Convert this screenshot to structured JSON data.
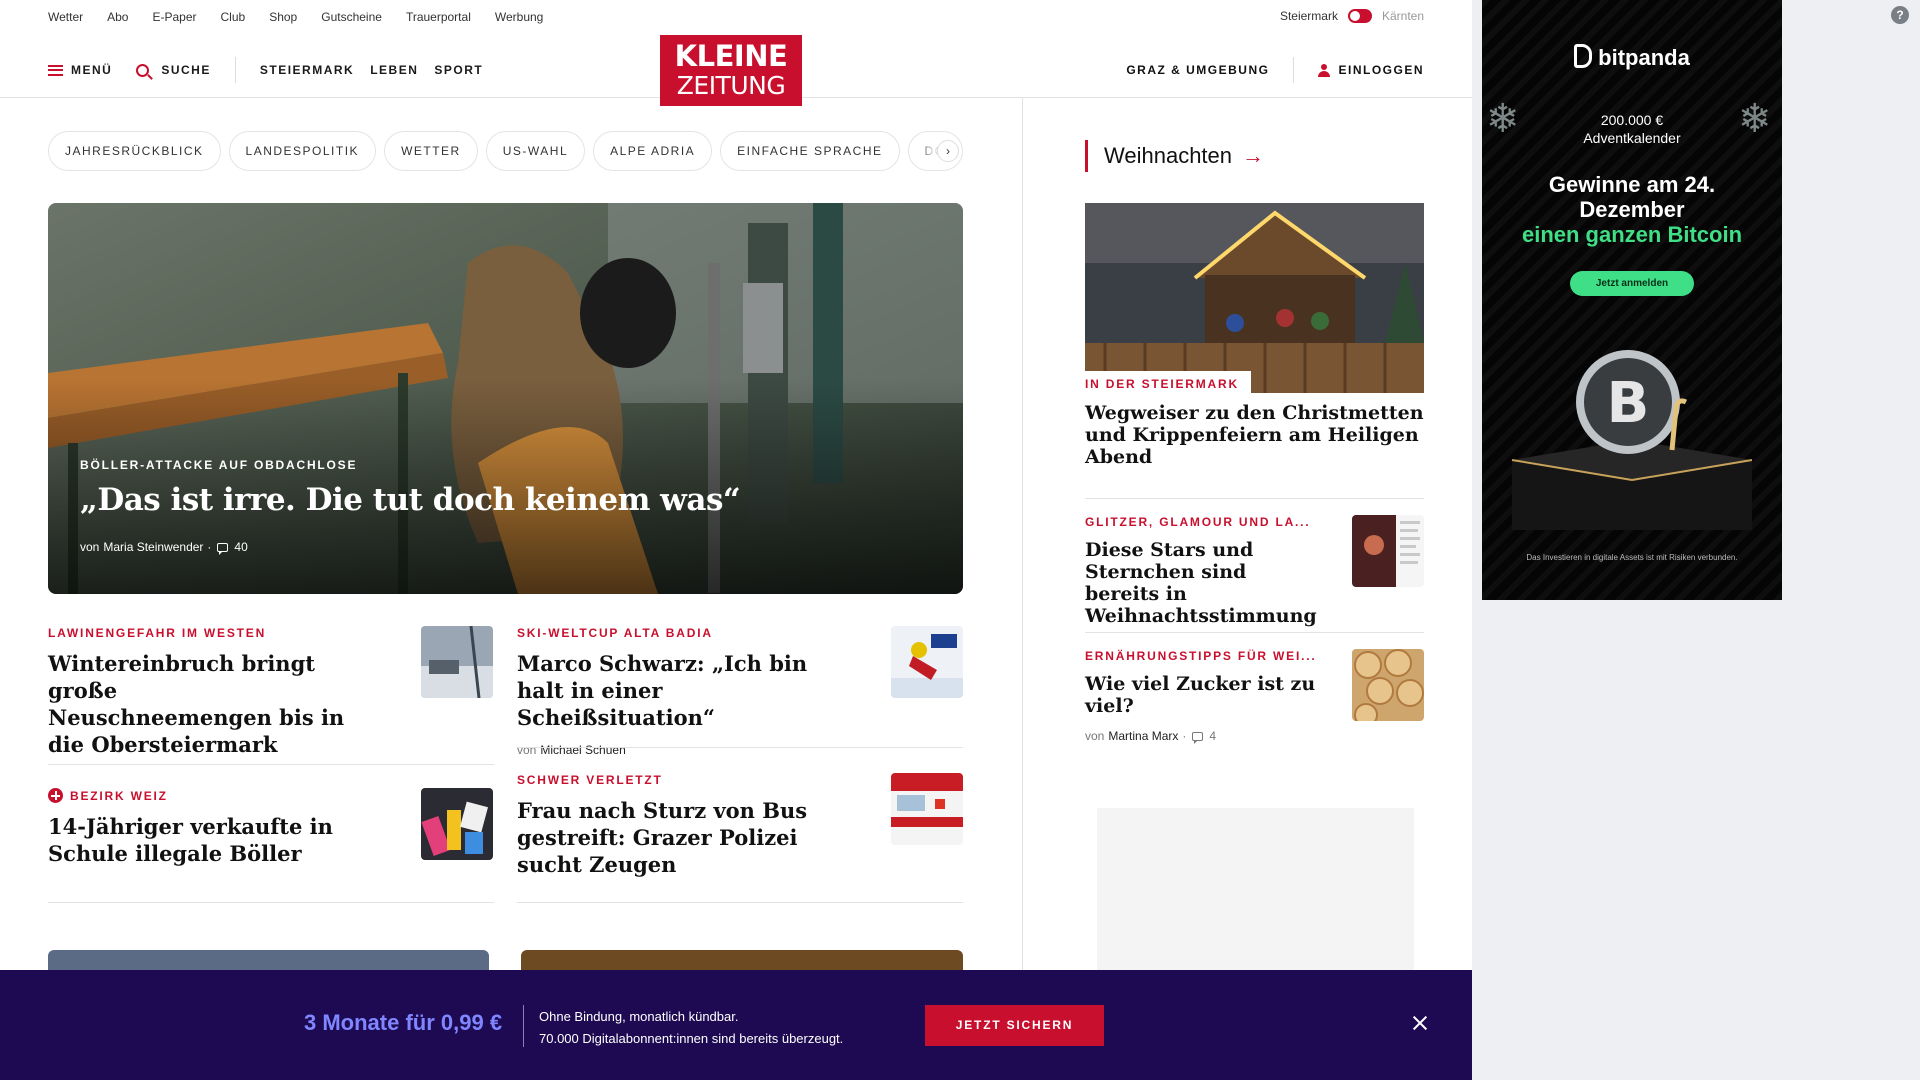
{
  "utility": {
    "links": [
      "Wetter",
      "Abo",
      "E-Paper",
      "Club",
      "Shop",
      "Gutscheine",
      "Trauerportal",
      "Werbung"
    ],
    "region_left": "Steiermark",
    "region_right": "Kärnten"
  },
  "header": {
    "menu_label": "MENÜ",
    "search_label": "SUCHE",
    "nav": [
      "STEIERMARK",
      "LEBEN",
      "SPORT"
    ],
    "logo_line1": "KLEINE",
    "logo_line2": "ZEITUNG",
    "region_nav": "GRAZ & UMGEBUNG",
    "login_label": "EINLOGGEN",
    "brand_color": "#c8102e"
  },
  "topics": [
    "JAHRESRÜCKBLICK",
    "LANDESPOLITIK",
    "WETTER",
    "US-WAHL",
    "ALPE ADRIA",
    "EINFACHE SPRACHE",
    "DO"
  ],
  "hero": {
    "kicker": "BÖLLER-ATTACKE AUF OBDACHLOSE",
    "title": "„Das ist irre. Die tut doch keinem was“",
    "by": "von",
    "author": "Maria Steinwender",
    "comments": "40"
  },
  "articles": [
    {
      "kicker": "LAWINENGEFAHR IM WESTEN",
      "title": "Wintereinbruch bringt große Neuschneemengen bis in die Obersteiermark"
    },
    {
      "kicker": "SKI-WELTCUP ALTA BADIA",
      "title": "Marco Schwarz: „Ich bin halt in einer Scheißsituation“",
      "by": "von",
      "author": "Michael Schuen"
    },
    {
      "kicker": "BEZIRK WEIZ",
      "plus": true,
      "title": "14-Jähriger verkaufte in Schule illegale Böller"
    },
    {
      "kicker": "SCHWER VERLETZT",
      "title": "Frau nach Sturz von Bus gestreift: Grazer Polizei sucht Zeugen"
    }
  ],
  "rail": {
    "section": "Weihnachten",
    "main_kicker": "IN DER STEIERMARK",
    "main_title": "Wegweiser zu den Christmetten und Krippenfeiern am Heiligen Abend",
    "items": [
      {
        "kicker": "GLITZER, GLAMOUR UND LA...",
        "title": "Diese Stars und Sternchen sind bereits in Weihnachtsstimmung"
      },
      {
        "kicker": "ERNÄHRUNGSTIPPS FÜR WEI...",
        "title": "Wie viel Zucker ist zu viel?",
        "by": "von",
        "author": "Martina Marx",
        "comments": "4"
      }
    ]
  },
  "ad": {
    "brand": "bitpanda",
    "line1a": "200.000 €",
    "line1b": "Adventkalender",
    "headline1": "Gewinne am 24.",
    "headline2": "Dezember",
    "highlight": "einen ganzen Bitcoin",
    "cta": "Jetzt anmelden",
    "disclaimer": "Das Investieren in digitale Assets ist mit Risiken verbunden.",
    "accent": "#3fdf88"
  },
  "promo": {
    "price": "3 Monate für 0,99 €",
    "text1": "Ohne Bindung, monatlich kündbar.",
    "text2": "70.000 Digitalabonnent:innen sind bereits überzeugt.",
    "button": "JETZT SICHERN",
    "background": "#1e0a52"
  },
  "help_icon": "?"
}
